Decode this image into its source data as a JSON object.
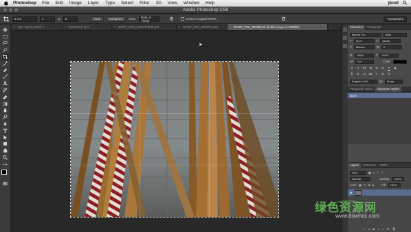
{
  "menubar": {
    "app_name": "Photoshop",
    "items": [
      "File",
      "Edit",
      "Image",
      "Layer",
      "Type",
      "Select",
      "Filter",
      "3D",
      "View",
      "Window",
      "Help"
    ],
    "user": "jkost"
  },
  "window": {
    "title": "Adobe Photoshop CS6"
  },
  "options": {
    "ratio": "4 x 5",
    "width": "4",
    "height": "5",
    "straighten_label": "Straighten",
    "view_label": "View:",
    "view_value": "Rule of Thirds",
    "delete_cropped_label": "Delete Cropped Pixels",
    "workspace": "Typography"
  },
  "tabs": [
    {
      "label": "Type Styles.psd @ 1...",
      "active": false
    },
    {
      "label": "Vector23.tif @ 1...",
      "active": false
    },
    {
      "label": "JKOST_2011_04819THEdit.psd",
      "active": false
    },
    {
      "label": "JKOST_2011_09927fot.psd",
      "active": false
    },
    {
      "label": "JKOST_2011_03268.psd @ 25% (Layer 0, RGB/8*)",
      "active": true
    },
    {
      "label": "»",
      "active": false
    }
  ],
  "character_panel": {
    "tabs": [
      "Character",
      "Paragraph"
    ],
    "font_family": "Myriad Pro",
    "font_style": "Bold",
    "size": "12 pt",
    "leading": "(Auto)",
    "kerning": "Metrics",
    "tracking": "0",
    "vscale": "100%",
    "hscale": "100%",
    "baseline": "0 pt",
    "color_label": "Color:",
    "language": "English: USA",
    "antialias": "Sharp"
  },
  "styles_panel": {
    "tabs": [
      "Paragraph Styles",
      "Character Styles"
    ],
    "items": [
      "None"
    ]
  },
  "layers_panel": {
    "tabs": [
      "Layers",
      "Channels",
      "Paths"
    ],
    "kind_label": "Kind",
    "blend_mode": "Normal",
    "opacity_label": "Opacity:",
    "opacity": "100%",
    "lock_label": "Lock:",
    "fill_label": "Fill:",
    "fill": "100%"
  },
  "watermark": {
    "text": "绿色资源网",
    "url": "www.downcc.com"
  },
  "colors": {
    "ui_dark": "#282828",
    "panel": "#4a4a4a",
    "selection_blue": "#5f6f94",
    "watermark_green": "#69c85a"
  }
}
